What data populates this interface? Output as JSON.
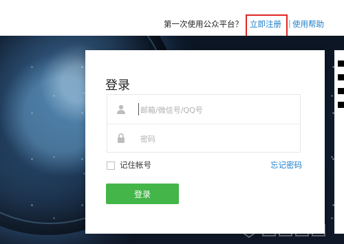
{
  "header": {
    "prompt": "第一次使用公众平台？",
    "register_link": "立即注册",
    "separator": "|",
    "help_link": "使用帮助"
  },
  "login": {
    "title": "登录",
    "username_placeholder": "邮箱/微信号/QQ号",
    "password_placeholder": "密码",
    "remember_label": "记住帐号",
    "forgot_link": "忘记密码",
    "submit_label": "登录"
  },
  "colors": {
    "link_blue": "#1f7fcc",
    "highlight_red": "#e02525",
    "login_green": "#44b549"
  },
  "icons": {
    "username_icon": "user-icon",
    "password_icon": "lock-icon",
    "qr_icon": "qr-code-icon"
  }
}
